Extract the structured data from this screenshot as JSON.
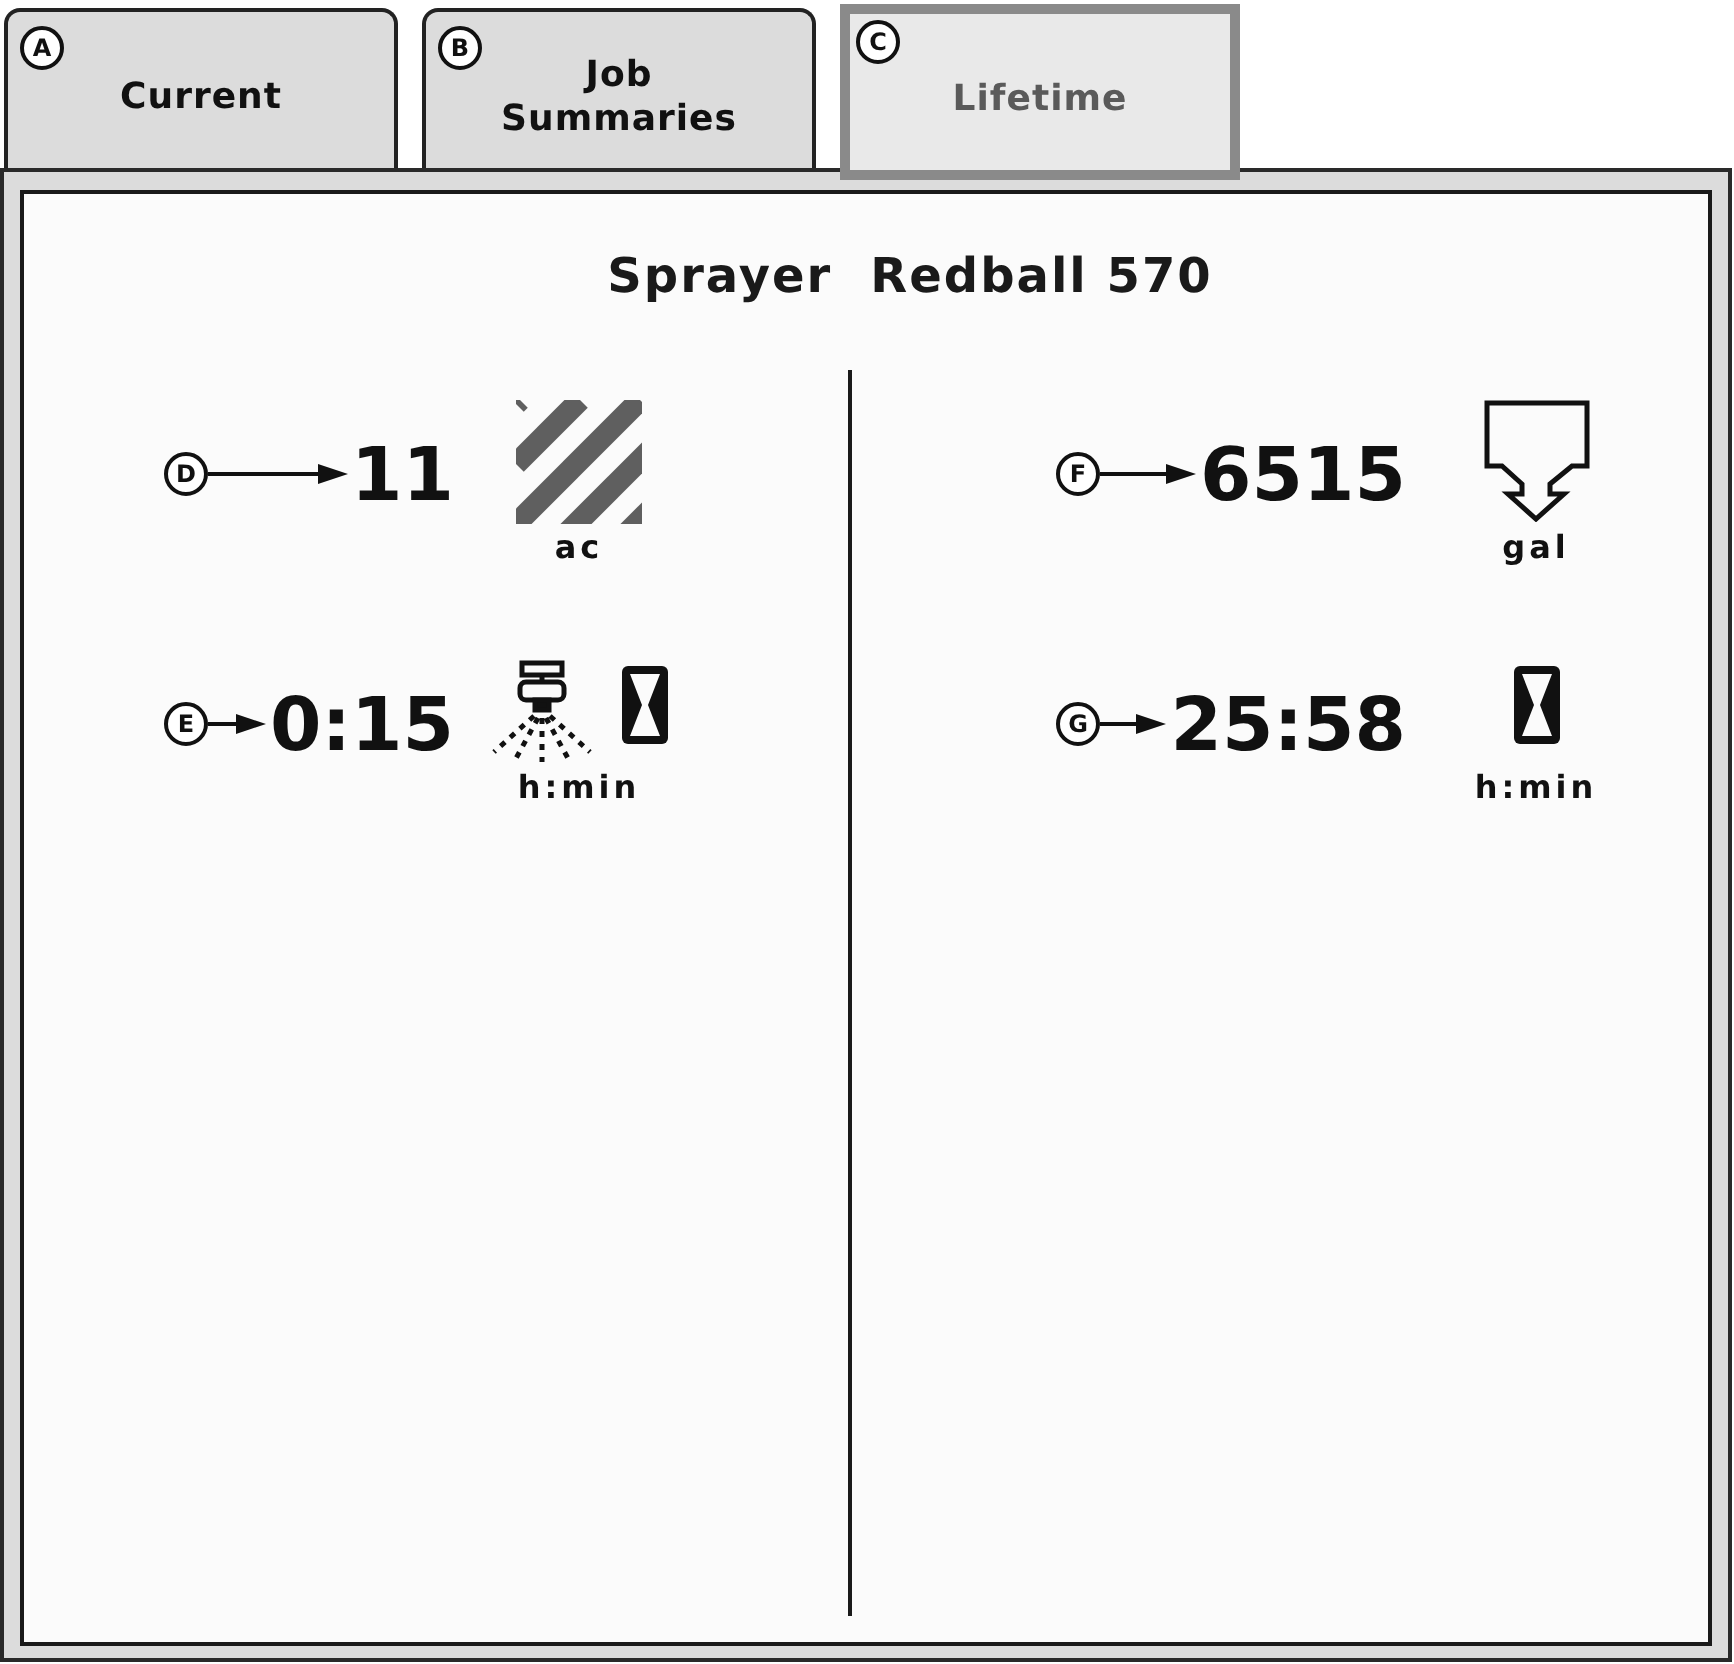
{
  "tabs": [
    {
      "callout": "A",
      "label": "Current",
      "selected": false
    },
    {
      "callout": "B",
      "label": "Job Summaries",
      "selected": false
    },
    {
      "callout": "C",
      "label": "Lifetime",
      "selected": true
    }
  ],
  "title": {
    "machine_type": "Sprayer",
    "machine_name": "Redball 570"
  },
  "columns": [
    {
      "rows": [
        {
          "callout": "D",
          "value": "11",
          "icons": [
            {
              "kind": "area"
            }
          ],
          "unit": "ac"
        },
        {
          "callout": "E",
          "value": "0:15",
          "icons": [
            {
              "kind": "sprayer"
            },
            {
              "kind": "hourglass"
            }
          ],
          "unit": "h:min"
        }
      ]
    },
    {
      "rows": [
        {
          "callout": "F",
          "value": "6515",
          "icons": [
            {
              "kind": "tank"
            }
          ],
          "unit": "gal"
        },
        {
          "callout": "G",
          "value": "25:58",
          "icons": [
            {
              "kind": "hourglass"
            }
          ],
          "unit": "h:min"
        }
      ]
    }
  ]
}
